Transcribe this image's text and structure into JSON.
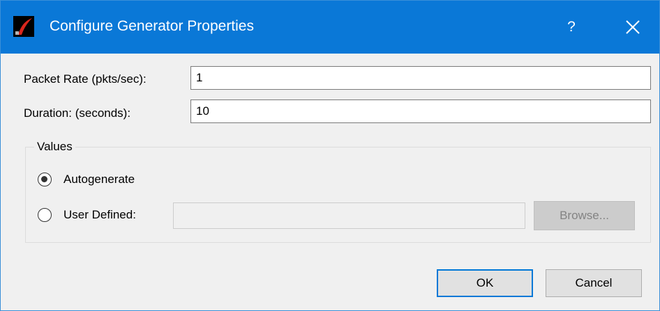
{
  "window": {
    "title": "Configure Generator Properties",
    "help_label": "?",
    "accent_color": "#0a78d7"
  },
  "icons": {
    "app": "app-icon",
    "close": "close-icon"
  },
  "form": {
    "packet_rate": {
      "label": "Packet Rate (pkts/sec):",
      "value": "1"
    },
    "duration": {
      "label": "Duration: (seconds):",
      "value": "10"
    }
  },
  "values_group": {
    "title": "Values",
    "autogenerate": {
      "label": "Autogenerate",
      "selected": true
    },
    "user_defined": {
      "label": "User Defined:",
      "selected": false,
      "value": ""
    },
    "browse_label": "Browse..."
  },
  "buttons": {
    "ok": "OK",
    "cancel": "Cancel"
  }
}
